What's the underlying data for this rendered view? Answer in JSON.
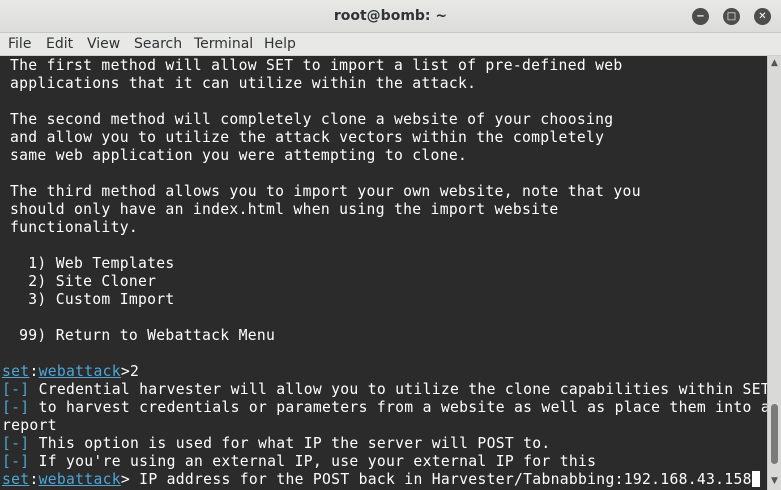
{
  "window": {
    "title": "root@bomb: ~",
    "minimize_icon": "minus-icon",
    "maximize_icon": "maximize-icon",
    "close_icon": "close-icon",
    "minimize_glyph": "−",
    "maximize_glyph": "□",
    "close_glyph": "✕"
  },
  "menu": [
    "File",
    "Edit",
    "View",
    "Search",
    "Terminal",
    "Help"
  ],
  "terminal": {
    "lines": [
      {
        "text": "The first method will allow SET to import a list of pre-defined web"
      },
      {
        "text": "applications that it can utilize within the attack."
      },
      {
        "text": ""
      },
      {
        "text": "The second method will completely clone a website of your choosing"
      },
      {
        "text": "and allow you to utilize the attack vectors within the completely"
      },
      {
        "text": "same web application you were attempting to clone."
      },
      {
        "text": ""
      },
      {
        "text": "The third method allows you to import your own website, note that you"
      },
      {
        "text": "should only have an index.html when using the import website"
      },
      {
        "text": "functionality."
      },
      {
        "text": ""
      },
      {
        "text": "  1) Web Templates"
      },
      {
        "text": "  2) Site Cloner"
      },
      {
        "text": "  3) Custom Import"
      },
      {
        "text": ""
      },
      {
        "text": " 99) Return to Webattack Menu"
      },
      {
        "text": ""
      }
    ],
    "prompt1": {
      "set": "set",
      "sep": ":",
      "module": "webattack",
      "input": ">2"
    },
    "info_lines": [
      {
        "tag": "[-]",
        "text": " Credential harvester will allow you to utilize the clone capabilities within SET"
      },
      {
        "tag": "[-]",
        "text": " to harvest credentials or parameters from a website as well as place them into a"
      },
      {
        "tag": "",
        "text": "report"
      },
      {
        "tag": "[-]",
        "text": " This option is used for what IP the server will POST to."
      },
      {
        "tag": "[-]",
        "text": " If you're using an external IP, use your external IP for this"
      }
    ],
    "prompt2": {
      "set": "set",
      "sep": ":",
      "module": "webattack",
      "input": "> IP address for the POST back in Harvester/Tabnabbing:192.168.43.158"
    }
  },
  "colors": {
    "background": "#2b2b2b",
    "text": "#ffffff",
    "accent": "#4ea6d6"
  }
}
